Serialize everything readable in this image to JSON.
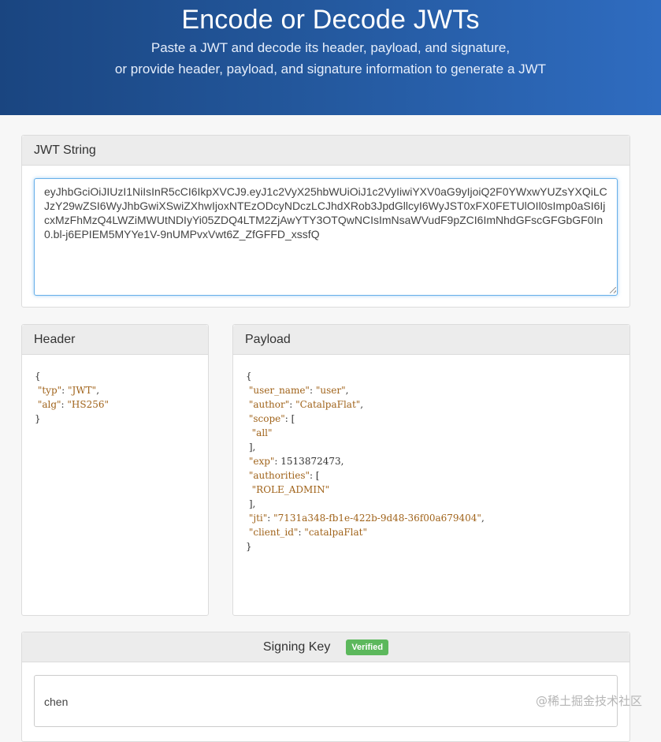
{
  "hero": {
    "title": "Encode or Decode JWTs",
    "subtitle_line1": "Paste a JWT and decode its header, payload, and signature,",
    "subtitle_line2": "or provide header, payload, and signature information to generate a JWT"
  },
  "jwt_panel": {
    "title": "JWT String",
    "value": "eyJhbGciOiJIUzI1NiIsInR5cCI6IkpXVCJ9.eyJ1c2VyX25hbWUiOiJ1c2VyIiwiYXV0aG9yIjoiQ2F0YWxwYUZsYXQiLCJzY29wZSI6WyJhbGwiXSwiZXhwIjoxNTEzODcyNDczLCJhdXRob3JpdGllcyI6WyJST0xFX0FETUlOIl0sImp0aSI6IjcxMzFhMzQ4LWZiMWUtNDIyYi05ZDQ4LTM2ZjAwYTY3OTQwNCIsImNsaWVudF9pZCI6ImNhdGFscGFGbGF0In0.bl-j6EPIEM5MYYe1V-9nUMPvxVwt6Z_ZfGFFD_xssfQ"
  },
  "header_panel": {
    "title": "Header",
    "typ_key": "\"typ\"",
    "typ_val": "\"JWT\"",
    "alg_key": "\"alg\"",
    "alg_val": "\"HS256\""
  },
  "payload_panel": {
    "title": "Payload",
    "user_name_key": "\"user_name\"",
    "user_name_val": "\"user\"",
    "author_key": "\"author\"",
    "author_val": "\"CatalpaFlat\"",
    "scope_key": "\"scope\"",
    "scope_item": "\"all\"",
    "exp_key": "\"exp\"",
    "exp_val": "1513872473",
    "authorities_key": "\"authorities\"",
    "authorities_item": "\"ROLE_ADMIN\"",
    "jti_key": "\"jti\"",
    "jti_val": "\"7131a348-fb1e-422b-9d48-36f00a679404\"",
    "client_id_key": "\"client_id\"",
    "client_id_val": "\"catalpaFlat\""
  },
  "signing_panel": {
    "title": "Signing Key",
    "badge": "Verified",
    "value": "chen"
  },
  "watermark": "@稀土掘金技术社区",
  "colors": {
    "hero_start": "#1a4580",
    "hero_end": "#2f6cc0",
    "verified": "#5cb85c"
  }
}
